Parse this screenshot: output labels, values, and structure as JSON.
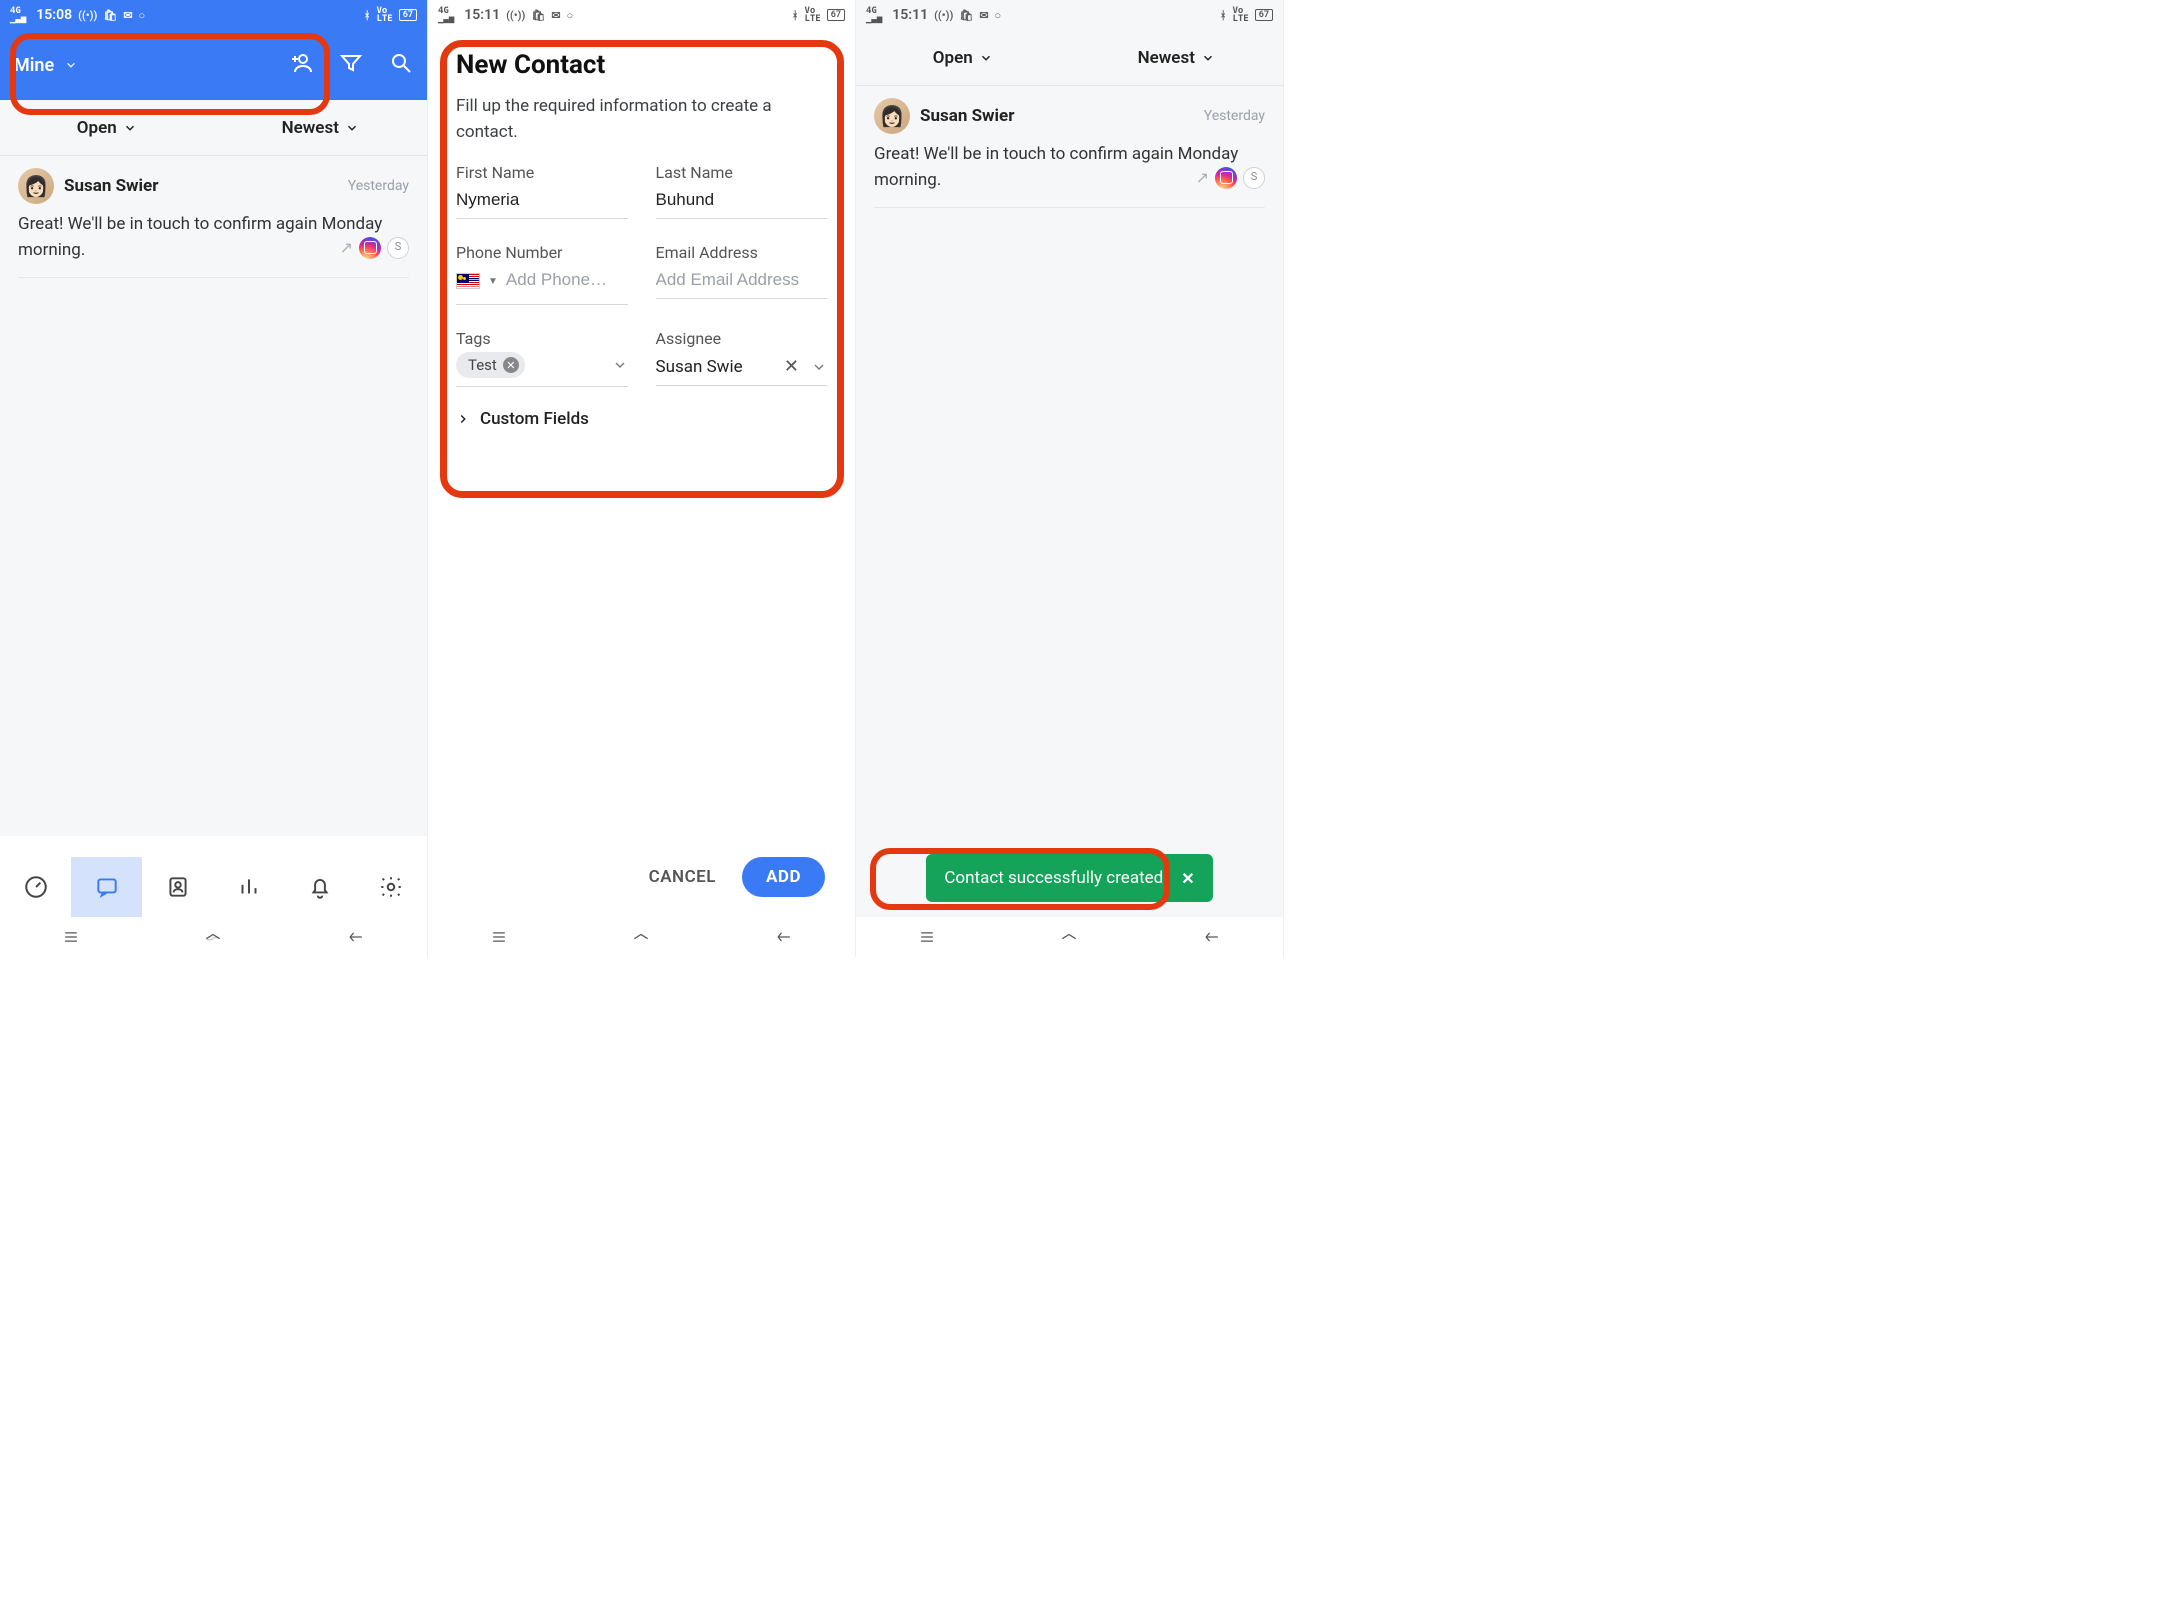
{
  "status": {
    "time1": "15:08",
    "time2": "15:11",
    "time3": "15:11",
    "battery": "67",
    "net": "4G"
  },
  "screen1": {
    "header_mine": "Mine",
    "filter_open": "Open",
    "filter_newest": "Newest",
    "msg_name": "Susan Swier",
    "msg_time": "Yesterday",
    "msg_text": "Great! We'll be in touch to confirm again Monday morning.",
    "s_badge": "S"
  },
  "screen2": {
    "title": "New Contact",
    "subtitle": "Fill up the required information to create a contact.",
    "first_name_label": "First Name",
    "first_name_value": "Nymeria",
    "last_name_label": "Last Name",
    "last_name_value": "Buhund",
    "phone_label": "Phone Number",
    "phone_placeholder": "Add Phone…",
    "email_label": "Email Address",
    "email_placeholder": "Add Email Address",
    "tags_label": "Tags",
    "tag_value": "Test",
    "assignee_label": "Assignee",
    "assignee_value": "Susan Swie",
    "custom_fields": "Custom Fields",
    "cancel": "CANCEL",
    "add": "ADD"
  },
  "screen3": {
    "filter_open": "Open",
    "filter_newest": "Newest",
    "msg_name": "Susan Swier",
    "msg_time": "Yesterday",
    "msg_text": "Great! We'll be in touch to confirm again Monday morning.",
    "s_badge": "S",
    "toast": "Contact successfully created"
  }
}
